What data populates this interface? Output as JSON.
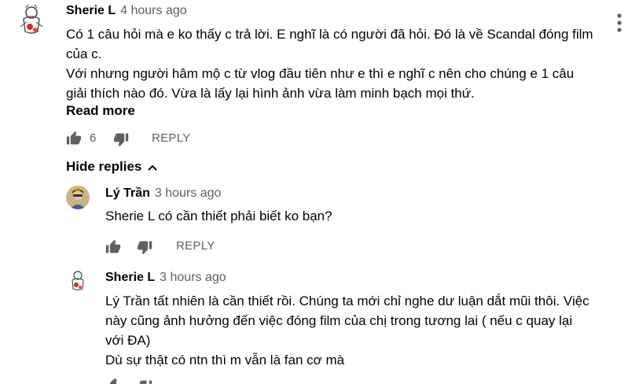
{
  "comment": {
    "author": "Sherie L",
    "time": "4 hours ago",
    "lines": [
      "Có 1 câu hỏi mà e ko thấy c trả lời. E nghĩ là có người đã hỏi. Đó là về Scandal đóng film",
      "của c.",
      "Với nhưng người hâm mộ c từ vlog đầu tiên như e thì e nghĩ c nên cho chúng e 1 câu",
      "giải thích nào đó. Vừa là lấy lại hình ảnh vừa làm minh bạch mọi thứ."
    ],
    "read_more": "Read more",
    "likes": "6",
    "reply_label": "REPLY",
    "hide_replies": "Hide replies"
  },
  "replies": [
    {
      "author": "Lý Trần",
      "time": "3 hours ago",
      "lines": [
        "Sherie L có cần thiết phải biết ko bạn?"
      ],
      "reply_label": "REPLY"
    },
    {
      "author": "Sherie L",
      "time": "3 hours ago",
      "lines": [
        "Lý Trần tất nhiên là cần thiết rồi. Chúng ta mới chỉ nghe dư luận dắt mũi thôi. Việc",
        "này cũng ảnh hưởng đến việc đóng film của chị trong tương lai ( nếu c quay lại",
        "với ĐA)",
        "Dù sự thật có ntn thì m vẫn là fan cơ mà"
      ]
    }
  ],
  "icons": {
    "like": "thumbs-up-icon",
    "dislike": "thumbs-down-icon",
    "menu": "more-vertical-icon",
    "chevron": "chevron-up-icon"
  }
}
